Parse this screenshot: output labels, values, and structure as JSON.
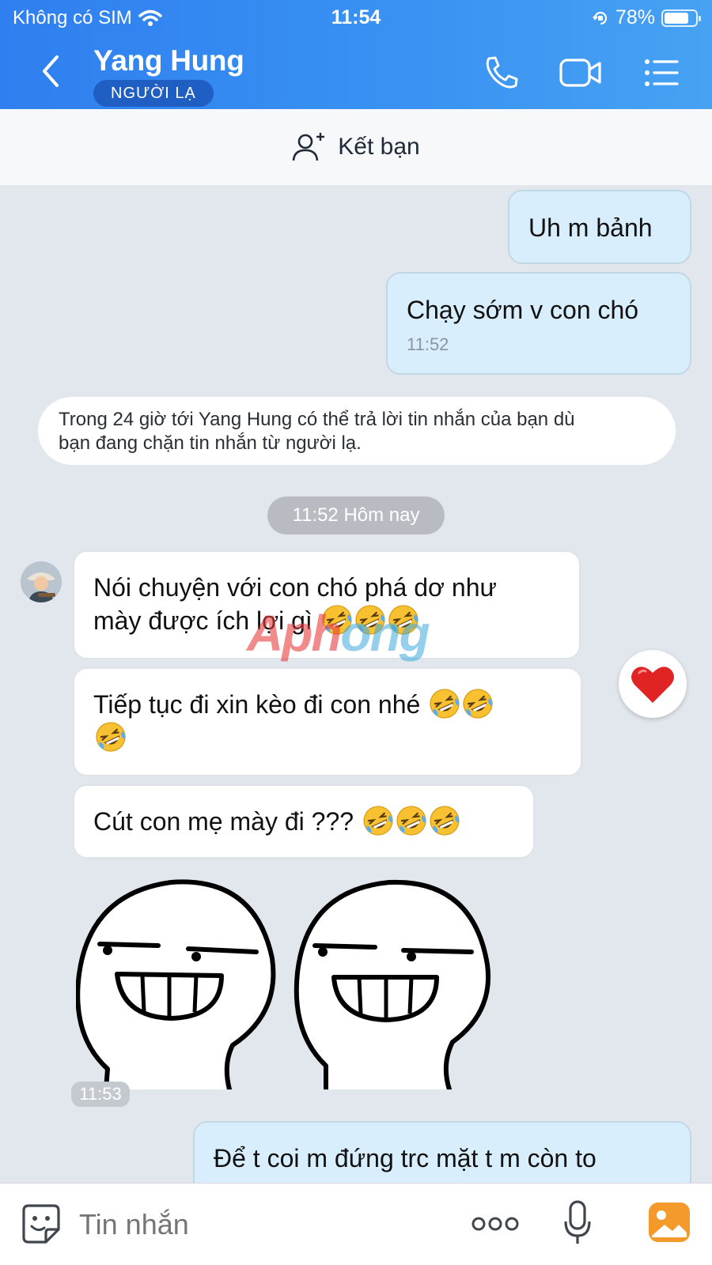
{
  "status_bar": {
    "carrier": "Không có SIM",
    "time": "11:54",
    "battery": "78%",
    "battery_level": 0.78
  },
  "header": {
    "contact_name": "Yang Hung",
    "badge": "NGƯỜI LẠ"
  },
  "friend_bar": {
    "label": "Kết bạn"
  },
  "messages": {
    "out_1": "Uh m bảnh",
    "out_2": "Chạy sớm v con chó",
    "out_2_time": "11:52",
    "notice_line_1": "Trong 24 giờ tới Yang Hung có thể trả lời tin nhắn của bạn dù",
    "notice_line_2": "bạn đang chặn tin nhắn từ người lạ.",
    "date_separator": "11:52 Hôm nay",
    "in_1_line_1": "Nói chuyện với con chó phá dơ như",
    "in_1_line_2": "mày được ích lợi gì",
    "in_2_line_1": "Tiếp tục đi xin kèo đi con nhé",
    "in_3": "Cút con mẹ mày đi ???",
    "sticker_time": "11:53",
    "out_3_partial": "Để t coi m đứng trc mặt t m còn to"
  },
  "watermark": {
    "part_1": "Aph",
    "part_2": "ong"
  },
  "input": {
    "placeholder": "Tin nhắn"
  },
  "colors": {
    "header_gradient_start": "#2f7ff0",
    "header_gradient_end": "#47a2f3",
    "badge_bg": "#1f5fc3",
    "chat_bg": "#e2e6ed",
    "outgoing_bubble": "#d9eefc",
    "incoming_bubble": "#ffffff",
    "reaction_heart": "#e02424",
    "gallery_icon": "#f39a2a"
  },
  "icons": {
    "back": "chevron-left-icon",
    "call": "phone-icon",
    "video": "video-camera-icon",
    "menu": "list-menu-icon",
    "add_friend": "add-user-icon",
    "reaction": "heart-icon",
    "sticker": "sticker-smile-icon",
    "more": "more-dots-icon",
    "voice": "microphone-icon",
    "gallery": "image-gallery-icon",
    "emoji": "rolling-on-floor-laughing-emoji"
  }
}
